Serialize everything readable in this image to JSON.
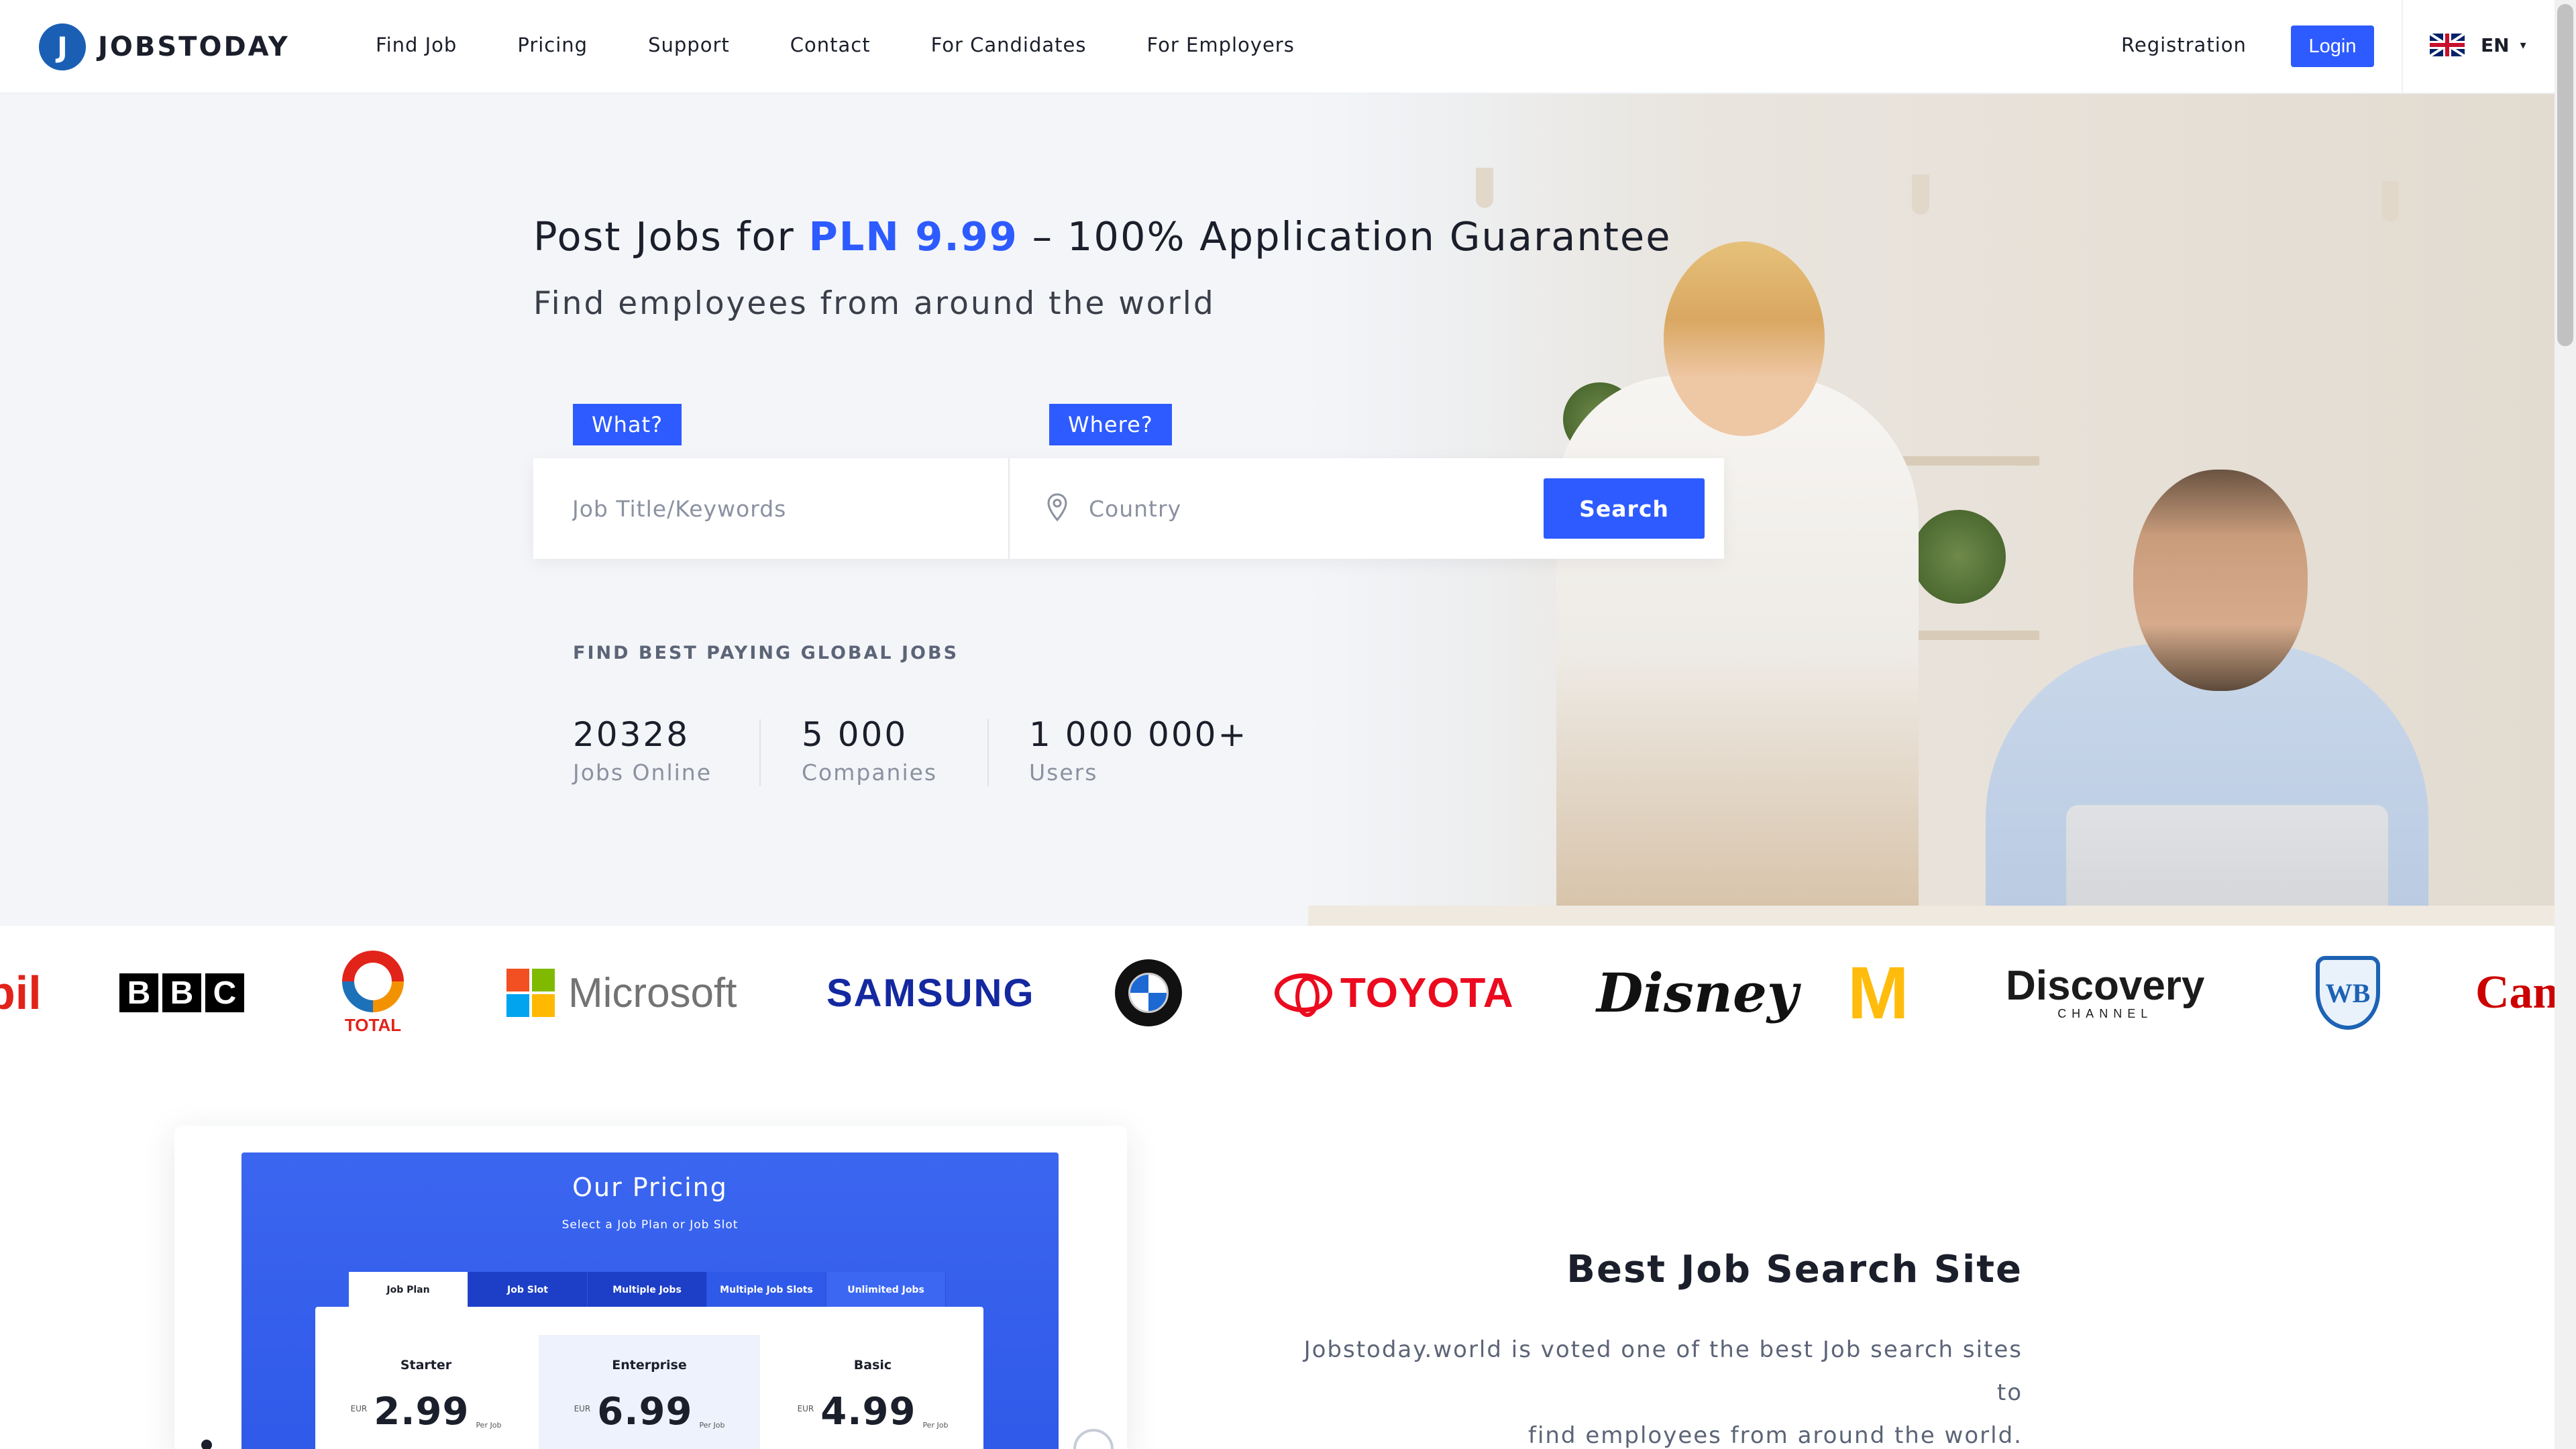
{
  "header": {
    "logo_letter": "J",
    "logo_text": "JOBSTODAY",
    "nav": [
      "Find Job",
      "Pricing",
      "Support",
      "Contact",
      "For Candidates",
      "For Employers"
    ],
    "registration": "Registration",
    "login": "Login",
    "language": "EN"
  },
  "hero": {
    "title_prefix": "Post Jobs for ",
    "title_price": "PLN 9.99",
    "title_suffix": " – 100% Application Guarantee",
    "subtitle": "Find employees from around the world",
    "what_tag": "What?",
    "where_tag": "Where?",
    "what_placeholder": "Job Title/Keywords",
    "where_placeholder": "Country",
    "search_button": "Search",
    "stats_heading": "FIND BEST PAYING GLOBAL JOBS",
    "stats": [
      {
        "value": "20328",
        "label": "Jobs Online"
      },
      {
        "value": "5 000",
        "label": "Companies"
      },
      {
        "value": "1 000 000+",
        "label": "Users"
      }
    ]
  },
  "brands": {
    "mobil": "bil",
    "bbc": [
      "B",
      "B",
      "C"
    ],
    "total": "TOTAL",
    "microsoft": "Microsoft",
    "samsung": "SAMSUNG",
    "bmw": "BMW",
    "toyota": "TOYOTA",
    "disney": "Disney",
    "mcdonalds": "M",
    "discovery": "Discovery",
    "discovery_sub": "CHANNEL",
    "wb": "WB",
    "canon": "Can"
  },
  "pricing": {
    "title": "Our Pricing",
    "subtitle": "Select a Job Plan or Job Slot",
    "tabs": [
      "Job Plan",
      "Job Slot",
      "Multiple Jobs",
      "Multiple Job Slots",
      "Unlimited Jobs"
    ],
    "plans": [
      {
        "name": "Starter",
        "currency": "EUR",
        "amount": "2.99",
        "per": "Per Job"
      },
      {
        "name": "Enterprise",
        "currency": "EUR",
        "amount": "6.99",
        "per": "Per Job"
      },
      {
        "name": "Basic",
        "currency": "EUR",
        "amount": "4.99",
        "per": "Per Job"
      }
    ]
  },
  "best": {
    "title": "Best Job Search Site",
    "text_line1": "Jobstoday.world is voted one of the best Job search sites to",
    "text_line2": "find employees from around the world."
  },
  "colors": {
    "accent": "#2d5bff",
    "text": "#1b1f2b",
    "muted": "#8b91a0"
  }
}
